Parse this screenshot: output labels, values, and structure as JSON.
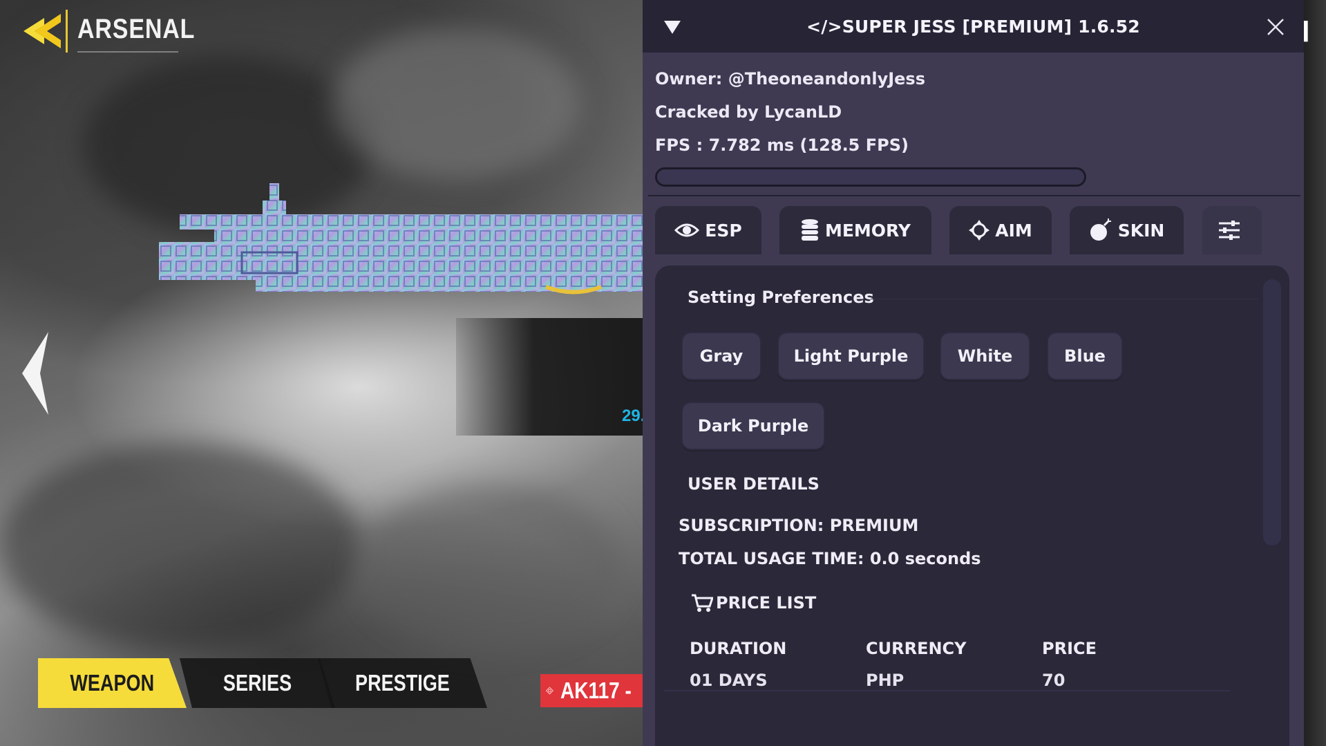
{
  "game": {
    "title": "ARSENAL",
    "side_number": "29.",
    "bottom_tabs": [
      "WEAPON",
      "SERIES",
      "PRESTIGE"
    ],
    "weapon_tag": "AK117 -",
    "accent_yellow": "#f5dc3a",
    "tag_red": "#e0353b"
  },
  "menu": {
    "title": "</>SUPER JESS [PREMIUM] 1.6.52",
    "owner": "Owner: @TheoneandonlyJess",
    "cracked": "Cracked by LycanLD",
    "fps": "FPS : 7.782 ms (128.5 FPS)",
    "tabs": [
      {
        "label": "ESP",
        "icon": "eye-icon"
      },
      {
        "label": "MEMORY",
        "icon": "database-icon"
      },
      {
        "label": "AIM",
        "icon": "crosshair-icon"
      },
      {
        "label": "SKIN",
        "icon": "bomb-icon"
      },
      {
        "label": "",
        "icon": "sliders-icon"
      }
    ],
    "preferences_title": "Setting Preferences",
    "color_options": [
      "Gray",
      "Light Purple",
      "White",
      "Blue",
      "Dark Purple"
    ],
    "user_details_title": "USER DETAILS",
    "subscription": "SUBSCRIPTION: PREMIUM",
    "usage_time": "TOTAL USAGE TIME: 0.0 seconds",
    "price_list_title": "PRICE LIST",
    "price_headers": [
      "DURATION",
      "CURRENCY",
      "PRICE"
    ],
    "price_rows": [
      [
        "01 DAYS",
        "PHP",
        "70"
      ]
    ],
    "panel_color": "#3f3a52",
    "header_color": "#272436"
  }
}
